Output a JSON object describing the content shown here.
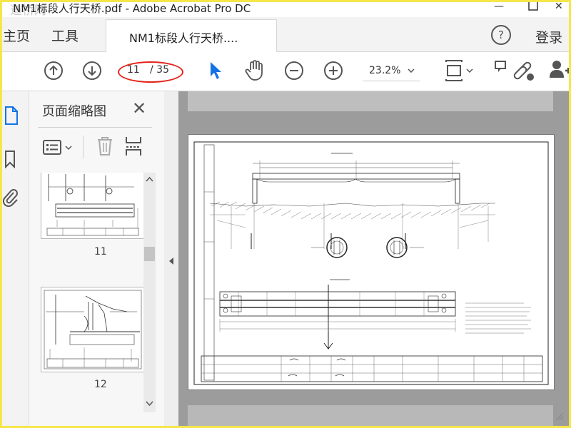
{
  "window": {
    "title": "NM1标段人行天桥.pdf - Adobe Acrobat Pro DC",
    "watermark": "道桥网",
    "minimize": "—",
    "close": "✕"
  },
  "tabs": {
    "home": "主页",
    "tools": "工具",
    "document": "NM1标段人行天桥....",
    "help": "?",
    "login": "登录"
  },
  "toolbar": {
    "page_current": "11",
    "page_total": "/ 35",
    "zoom": "23.2%",
    "icons": [
      "prev-page-icon",
      "next-page-icon",
      "select-cursor-icon",
      "hand-tool-icon",
      "zoom-out-icon",
      "zoom-in-icon",
      "fit-page-icon",
      "comment-icon",
      "share-link-icon",
      "user-add-icon"
    ]
  },
  "panel": {
    "title": "页面缩略图",
    "close": "✕",
    "thumbnails": [
      {
        "label": "11"
      },
      {
        "label": "12"
      }
    ]
  },
  "colors": {
    "accent": "#1473e6",
    "annotation": "#e2241a",
    "frame": "#f5e64a"
  }
}
